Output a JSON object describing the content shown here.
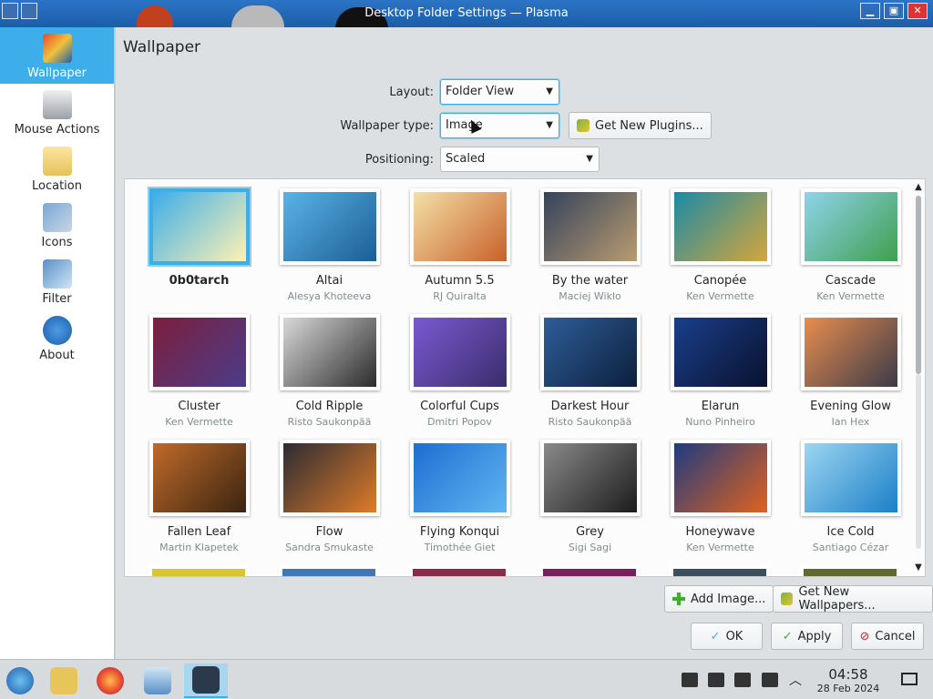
{
  "window": {
    "title": "Desktop Folder Settings — Plasma"
  },
  "sidebar": {
    "items": [
      {
        "label": "Wallpaper",
        "active": true,
        "icon": "wallpaper-icon"
      },
      {
        "label": "Mouse Actions",
        "active": false,
        "icon": "mouse-icon"
      },
      {
        "label": "Location",
        "active": false,
        "icon": "folder-icon"
      },
      {
        "label": "Icons",
        "active": false,
        "icon": "icons-icon"
      },
      {
        "label": "Filter",
        "active": false,
        "icon": "filter-icon"
      },
      {
        "label": "About",
        "active": false,
        "icon": "info-icon"
      }
    ]
  },
  "main": {
    "title": "Wallpaper",
    "layout": {
      "label": "Layout:",
      "value": "Folder View"
    },
    "wallpaper_type": {
      "label": "Wallpaper type:",
      "value": "Image",
      "plugins_button": "Get New Plugins..."
    },
    "positioning": {
      "label": "Positioning:",
      "value": "Scaled"
    }
  },
  "wallpapers": [
    {
      "name": "0b0tarch",
      "author": "",
      "selected": true,
      "colors": [
        "#3daee9",
        "#fff2b3"
      ]
    },
    {
      "name": "Altai",
      "author": "Alesya Khoteeva",
      "colors": [
        "#5ab3e6",
        "#1c5e96"
      ]
    },
    {
      "name": "Autumn 5.5",
      "author": "RJ Quiralta",
      "colors": [
        "#f3e1a6",
        "#c9602a"
      ]
    },
    {
      "name": "By the water",
      "author": "Maciej Wiklo",
      "colors": [
        "#34435c",
        "#b99b70"
      ]
    },
    {
      "name": "Canopée",
      "author": "Ken Vermette",
      "colors": [
        "#1b8aa6",
        "#d6a63b"
      ]
    },
    {
      "name": "Cascade",
      "author": "Ken Vermette",
      "colors": [
        "#8fd3ec",
        "#3ea04d"
      ]
    },
    {
      "name": "Cluster",
      "author": "Ken Vermette",
      "colors": [
        "#7c1f3d",
        "#4b3c8a"
      ]
    },
    {
      "name": "Cold Ripple",
      "author": "Risto Saukonpää",
      "colors": [
        "#d9d9d9",
        "#2b2b2b"
      ]
    },
    {
      "name": "Colorful Cups",
      "author": "Dmitri Popov",
      "colors": [
        "#7a5ad1",
        "#3a2d6b"
      ]
    },
    {
      "name": "Darkest Hour",
      "author": "Risto Saukonpää",
      "colors": [
        "#2e5e98",
        "#0d1f3c"
      ]
    },
    {
      "name": "Elarun",
      "author": "Nuno Pinheiro",
      "colors": [
        "#1a3f8a",
        "#0a112e"
      ]
    },
    {
      "name": "Evening Glow",
      "author": "Ian Hex",
      "colors": [
        "#e88d4f",
        "#3b3b48"
      ]
    },
    {
      "name": "Fallen Leaf",
      "author": "Martin Klapetek",
      "colors": [
        "#c06a2a",
        "#3a2411"
      ]
    },
    {
      "name": "Flow",
      "author": "Sandra Smukaste",
      "colors": [
        "#2b2b33",
        "#e07b28"
      ]
    },
    {
      "name": "Flying Konqui",
      "author": "Timothée Giet",
      "colors": [
        "#1d6ed0",
        "#5fb6f1"
      ]
    },
    {
      "name": "Grey",
      "author": "Sigi Sagi",
      "colors": [
        "#8a8a8a",
        "#1c1c1c"
      ]
    },
    {
      "name": "Honeywave",
      "author": "Ken Vermette",
      "colors": [
        "#1f3a80",
        "#e0631e"
      ]
    },
    {
      "name": "Ice Cold",
      "author": "Santiago Cézar",
      "colors": [
        "#9bd6f2",
        "#1c7fc7"
      ]
    }
  ],
  "partial_row_colors": [
    "#d7c62c",
    "#3e78b7",
    "#8c2a4a",
    "#7a1f5e",
    "#3b4f5c",
    "#5e6b2a"
  ],
  "buttons": {
    "add_image": "Add Image...",
    "get_wallpapers": "Get New Wallpapers...",
    "ok": "OK",
    "apply": "Apply",
    "cancel": "Cancel"
  },
  "taskbar": {
    "time": "04:58",
    "date": "28 Feb 2024"
  },
  "colors": {
    "accent": "#3daee9",
    "titlebar": "#1b5ea9"
  }
}
